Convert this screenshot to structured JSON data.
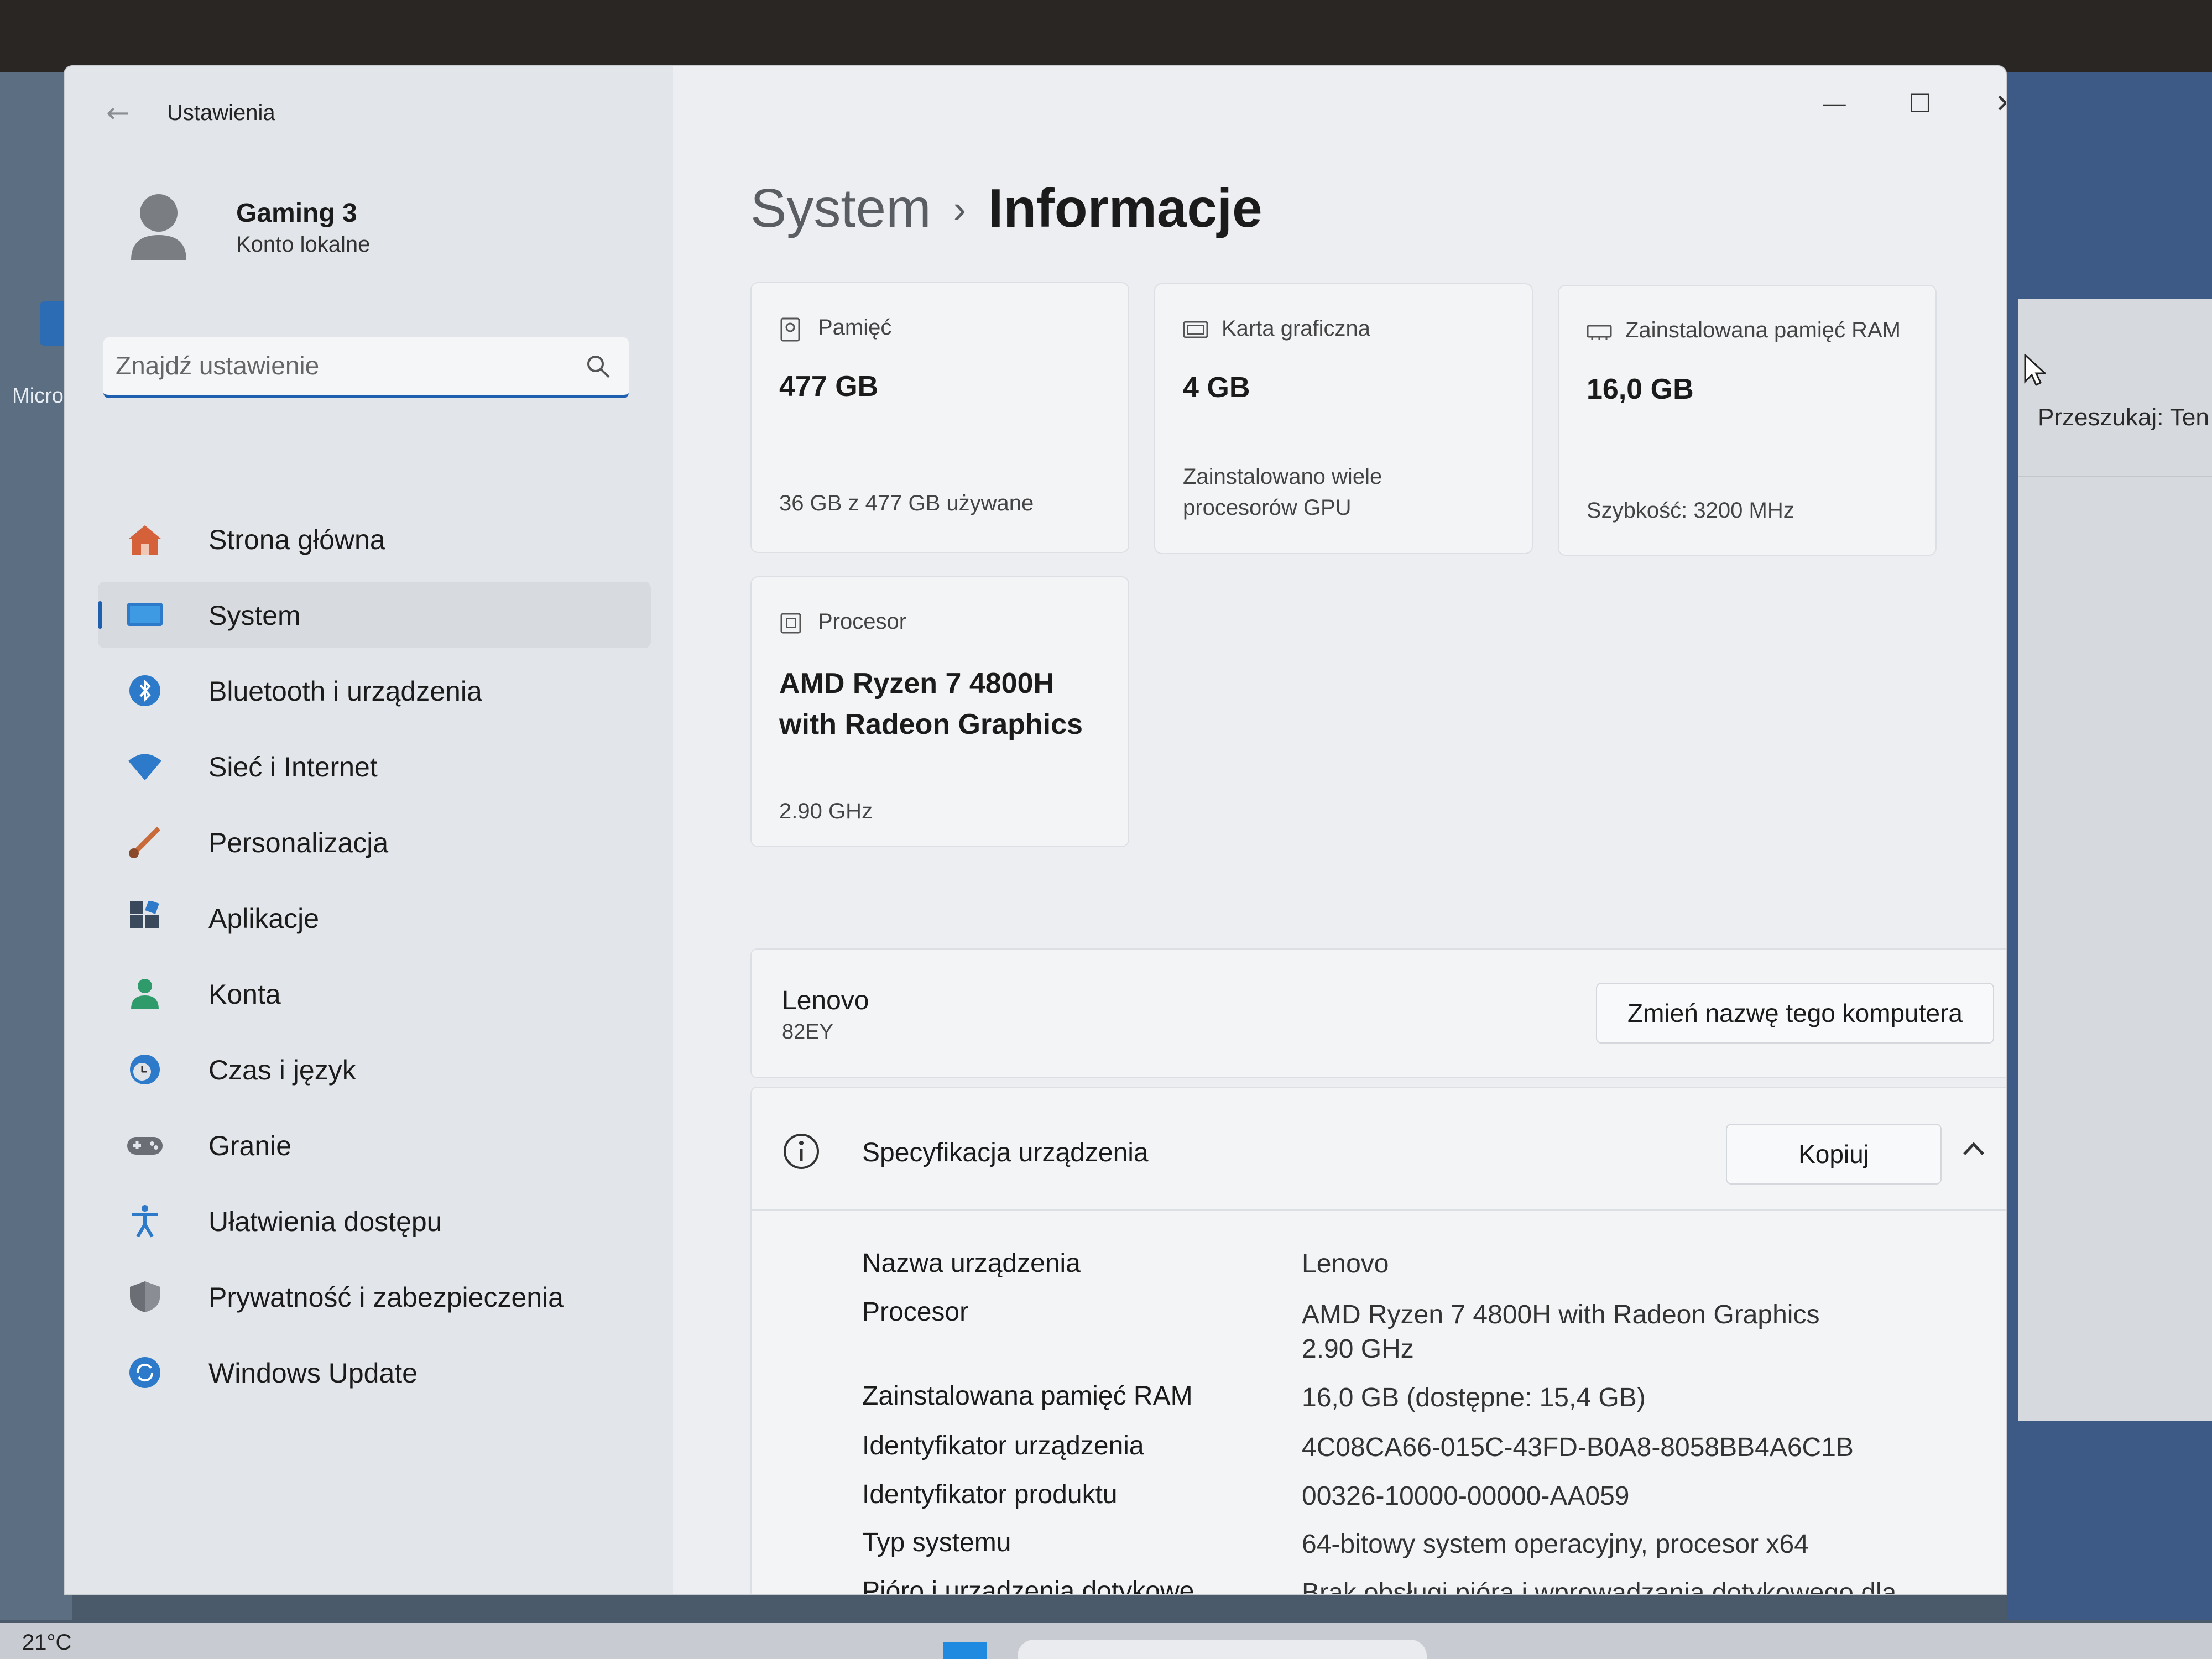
{
  "desktop": {
    "icon_label": "Micro",
    "right_panel_text": "Przeszukaj: Ten",
    "weather": "21°C"
  },
  "window": {
    "title": "Ustawienia",
    "minimize": "—",
    "maximize": "☐",
    "close": "✕"
  },
  "user": {
    "name": "Gaming 3",
    "account_type": "Konto lokalne"
  },
  "search": {
    "placeholder": "Znajdź ustawienie"
  },
  "sidebar": {
    "items": [
      {
        "label": "Strona główna",
        "icon": "home-icon"
      },
      {
        "label": "System",
        "icon": "system-icon",
        "active": true
      },
      {
        "label": "Bluetooth i urządzenia",
        "icon": "bluetooth-icon"
      },
      {
        "label": "Sieć i Internet",
        "icon": "wifi-icon"
      },
      {
        "label": "Personalizacja",
        "icon": "brush-icon"
      },
      {
        "label": "Aplikacje",
        "icon": "apps-icon"
      },
      {
        "label": "Konta",
        "icon": "person-icon"
      },
      {
        "label": "Czas i język",
        "icon": "clock-globe-icon"
      },
      {
        "label": "Granie",
        "icon": "gamepad-icon"
      },
      {
        "label": "Ułatwienia dostępu",
        "icon": "accessibility-icon"
      },
      {
        "label": "Prywatność i zabezpieczenia",
        "icon": "shield-icon"
      },
      {
        "label": "Windows Update",
        "icon": "update-icon"
      }
    ]
  },
  "breadcrumb": {
    "parent": "System",
    "separator": "›",
    "current": "Informacje"
  },
  "cards": {
    "storage": {
      "title": "Pamięć",
      "value": "477 GB",
      "sub": "36 GB z 477 GB używane"
    },
    "gpu": {
      "title": "Karta graficzna",
      "value": "4 GB",
      "sub_line1": "Zainstalowano wiele",
      "sub_line2": "procesorów GPU"
    },
    "ram": {
      "title": "Zainstalowana pamięć RAM",
      "value": "16,0 GB",
      "sub": "Szybkość: 3200 MHz"
    },
    "cpu": {
      "title": "Procesor",
      "value_line1": "AMD Ryzen 7 4800H",
      "value_line2": "with Radeon Graphics",
      "sub": "2.90 GHz"
    }
  },
  "device": {
    "name": "Lenovo",
    "model": "82EY",
    "rename_button": "Zmień nazwę tego komputera"
  },
  "specs": {
    "title": "Specyfikacja urządzenia",
    "copy_button": "Kopiuj",
    "rows": [
      {
        "label": "Nazwa urządzenia",
        "value": "Lenovo"
      },
      {
        "label": "Procesor",
        "value": "AMD Ryzen 7 4800H with Radeon Graphics",
        "value2": "2.90 GHz"
      },
      {
        "label": "Zainstalowana pamięć RAM",
        "value": "16,0 GB (dostępne: 15,4 GB)"
      },
      {
        "label": "Identyfikator urządzenia",
        "value": "4C08CA66-015C-43FD-B0A8-8058BB4A6C1B"
      },
      {
        "label": "Identyfikator produktu",
        "value": "00326-10000-00000-AA059"
      },
      {
        "label": "Typ systemu",
        "value": "64-bitowy system operacyjny, procesor x64"
      },
      {
        "label": "Pióro i urządzenia dotykowe",
        "value": "Brak obsługi pióra i wprowadzania dotykowego dla"
      }
    ]
  }
}
